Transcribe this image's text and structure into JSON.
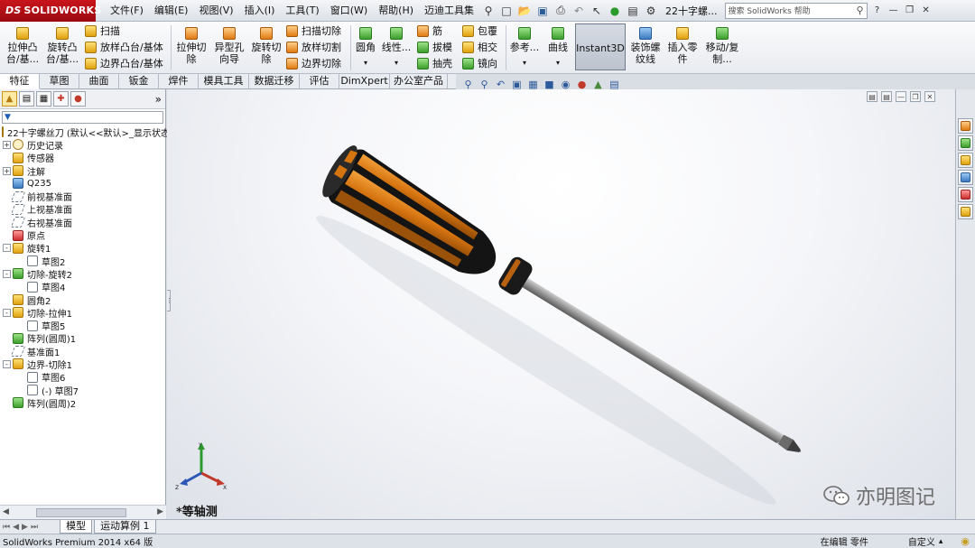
{
  "app": {
    "brand_ds": "DS",
    "brand_name": "SOLIDWORKS"
  },
  "menu": {
    "items": [
      "文件(F)",
      "编辑(E)",
      "视图(V)",
      "插入(I)",
      "工具(T)",
      "窗口(W)",
      "帮助(H)",
      "迈迪工具集"
    ],
    "doc_title": "22十字螺...",
    "search_placeholder": "搜索 SolidWorks 帮助"
  },
  "commands": {
    "extrude_boss": "拉伸凸台/基...",
    "revolve_boss": "旋转凸台/基...",
    "sweep": "扫描",
    "loft_boss": "放样凸台/基体",
    "boundary_boss": "边界凸台/基体",
    "extrude_cut": "拉伸切除",
    "hole_wizard": "异型孔向导",
    "revolve_cut": "旋转切除",
    "sweep_cut": "扫描切除",
    "loft_cut": "放样切割",
    "boundary_cut": "边界切除",
    "fillet": "圆角",
    "linear_pattern": "线性...",
    "rib": "筋",
    "wrap": "包覆",
    "draft": "拔模",
    "intersect": "相交",
    "shell": "抽壳",
    "mirror": "镜向",
    "reference": "参考...",
    "curves": "曲线",
    "instant3d": "Instant3D",
    "cosmetic_thread": "装饰螺纹线",
    "insert_part": "插入零件",
    "move_copy": "移动/复制..."
  },
  "tabs": [
    "特征",
    "草图",
    "曲面",
    "钣金",
    "焊件",
    "模具工具",
    "数据迁移",
    "评估",
    "DimXpert",
    "办公室产品"
  ],
  "tree": {
    "root": "22十字螺丝刀  (默认<<默认>_显示状态",
    "items": [
      {
        "label": "历史记录",
        "expand": "+",
        "indent": 0,
        "icon": "history"
      },
      {
        "label": "传感器",
        "expand": "",
        "indent": 0,
        "icon": "sensor"
      },
      {
        "label": "注解",
        "expand": "+",
        "indent": 0,
        "icon": "annotation"
      },
      {
        "label": "Q235",
        "expand": "",
        "indent": 0,
        "icon": "material"
      },
      {
        "label": "前视基准面",
        "expand": "",
        "indent": 0,
        "icon": "plane"
      },
      {
        "label": "上视基准面",
        "expand": "",
        "indent": 0,
        "icon": "plane"
      },
      {
        "label": "右视基准面",
        "expand": "",
        "indent": 0,
        "icon": "plane"
      },
      {
        "label": "原点",
        "expand": "",
        "indent": 0,
        "icon": "origin"
      },
      {
        "label": "旋转1",
        "expand": "-",
        "indent": 0,
        "icon": "revolve"
      },
      {
        "label": "草图2",
        "expand": "",
        "indent": 1,
        "icon": "sketch"
      },
      {
        "label": "切除-旋转2",
        "expand": "-",
        "indent": 0,
        "icon": "revolve-cut"
      },
      {
        "label": "草图4",
        "expand": "",
        "indent": 1,
        "icon": "sketch"
      },
      {
        "label": "圆角2",
        "expand": "",
        "indent": 0,
        "icon": "fillet"
      },
      {
        "label": "切除-拉伸1",
        "expand": "-",
        "indent": 0,
        "icon": "extrude-cut"
      },
      {
        "label": "草图5",
        "expand": "",
        "indent": 1,
        "icon": "sketch"
      },
      {
        "label": "阵列(圆周)1",
        "expand": "",
        "indent": 0,
        "icon": "pattern"
      },
      {
        "label": "基准面1",
        "expand": "",
        "indent": 0,
        "icon": "plane"
      },
      {
        "label": "边界-切除1",
        "expand": "-",
        "indent": 0,
        "icon": "boundary-cut"
      },
      {
        "label": "草图6",
        "expand": "",
        "indent": 1,
        "icon": "sketch"
      },
      {
        "label": "(-) 草图7",
        "expand": "",
        "indent": 1,
        "icon": "sketch"
      },
      {
        "label": "阵列(圆周)2",
        "expand": "",
        "indent": 0,
        "icon": "pattern"
      }
    ]
  },
  "viewport": {
    "view_name": "*等轴测",
    "watermark": "亦明图记"
  },
  "bottom_tabs": [
    "模型",
    "运动算例 1"
  ],
  "status": {
    "product": "SolidWorks Premium 2014 x64 版",
    "editing": "在编辑 零件",
    "units": "自定义"
  },
  "colors": {
    "brand_red": "#c8151b",
    "handle_orange": "#d97a12",
    "handle_black": "#111111",
    "shaft_gray": "#8a8a8a"
  }
}
